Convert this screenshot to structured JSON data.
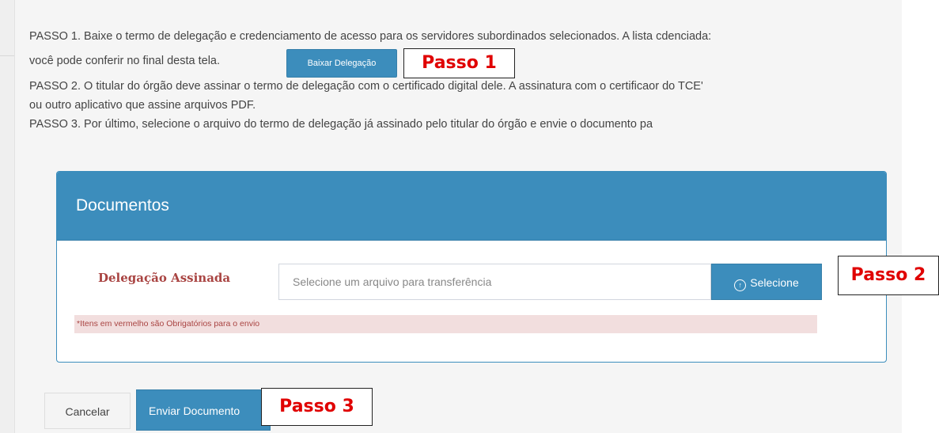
{
  "instructions": {
    "step1_line1": "PASSO 1. Baixe o termo de delegação e credenciamento de acesso para os servidores subordinados selecionados. A lista cdenciada:",
    "step1_line2": "você pode conferir no final desta tela.",
    "download_button": "Baixar Delegação",
    "step2_line1": "PASSO 2. O titular do órgão deve assinar o termo de delegação com o certificado digital dele. A assinatura com o certificaor do TCE'",
    "step2_line2": "ou outro aplicativo que assine arquivos PDF.",
    "step3_line1": "PASSO 3. Por último, selecione o arquivo do termo de delegação já assinado pelo titular do órgão e envie o documento pa"
  },
  "callouts": {
    "passo1": "Passo 1",
    "passo2": "Passo 2",
    "passo3": "Passo 3"
  },
  "panel": {
    "title": "Documentos",
    "field_label": "Delegação Assinada",
    "file_placeholder": "Selecione um arquivo para transferência",
    "select_button": "Selecione",
    "select_icon": "upload-circle-icon",
    "required_note": "*Itens em vermelho são Obrigatórios para o envio"
  },
  "actions": {
    "cancel": "Cancelar",
    "send": "Enviar Documento"
  },
  "colors": {
    "primary": "#3c8dbc",
    "callout_text": "#e00000",
    "required_text": "#a94442",
    "required_bg": "#f2dede"
  }
}
